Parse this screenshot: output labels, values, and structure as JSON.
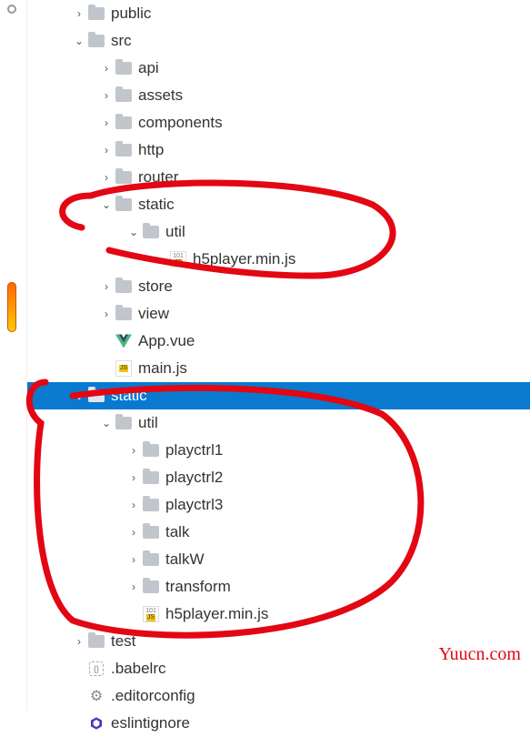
{
  "tree": {
    "public": "public",
    "src": "src",
    "api": "api",
    "assets": "assets",
    "components": "components",
    "http": "http",
    "router": "router",
    "static1": "static",
    "util1": "util",
    "h5player1": "h5player.min.js",
    "store": "store",
    "view": "view",
    "appvue": "App.vue",
    "mainjs": "main.js",
    "static2": "static",
    "util2": "util",
    "playctrl1": "playctrl1",
    "playctrl2": "playctrl2",
    "playctrl3": "playctrl3",
    "talk": "talk",
    "talkW": "talkW",
    "transform": "transform",
    "h5player2": "h5player.min.js",
    "test": "test",
    "babelrc": ".babelrc",
    "editorconfig": ".editorconfig",
    "eslintignore": "eslintignore"
  },
  "watermark": "Yuucn.com"
}
